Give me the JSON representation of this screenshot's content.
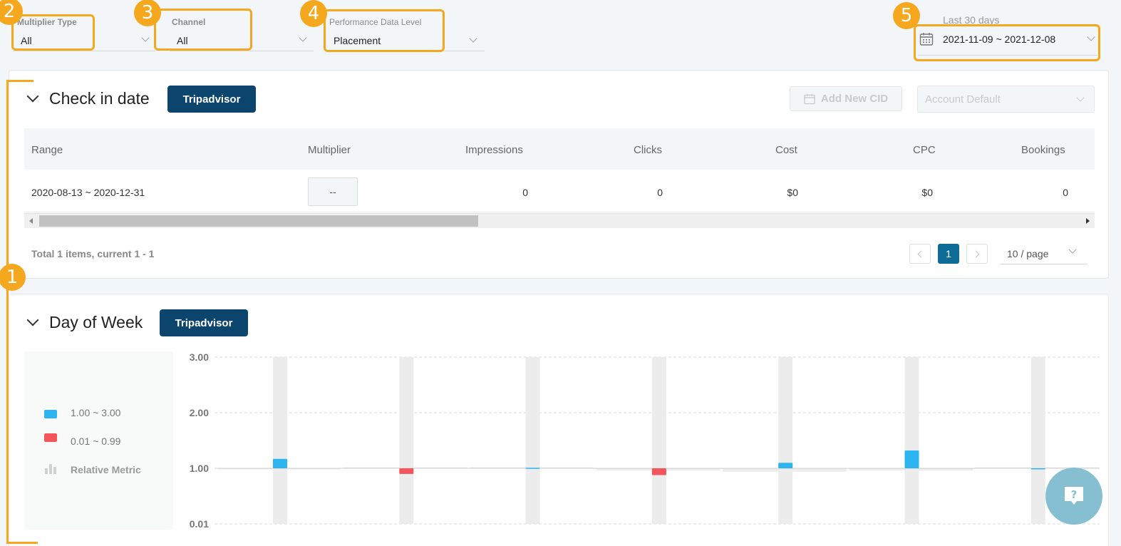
{
  "filters": {
    "multiplier_type": {
      "label": "Multiplier Type",
      "value": "All"
    },
    "channel": {
      "label": "Channel",
      "value": "All"
    },
    "performance_level": {
      "label": "Performance Data Level",
      "value": "Placement"
    },
    "date": {
      "label": "Last 30 days",
      "value": "2021-11-09 ~ 2021-12-08"
    }
  },
  "badges": [
    "1",
    "2",
    "3",
    "4",
    "5"
  ],
  "checkin": {
    "title": "Check in date",
    "tag": "Tripadvisor",
    "add_button": "Add New CID",
    "account_select": "Account Default",
    "columns": [
      "Range",
      "Multiplier",
      "Impressions",
      "Clicks",
      "Cost",
      "CPC",
      "Bookings"
    ],
    "row": {
      "range": "2020-08-13 ~ 2020-12-31",
      "multiplier": "--",
      "impressions": "0",
      "clicks": "0",
      "cost": "$0",
      "cpc": "$0",
      "bookings": "0"
    },
    "total": "Total 1 items, current 1 - 1",
    "page": "1",
    "page_size": "10 / page"
  },
  "dow": {
    "title": "Day of Week",
    "tag": "Tripadvisor",
    "legend": [
      {
        "label": "1.00 ~ 3.00",
        "color": "#2cb5f1"
      },
      {
        "label": "0.01 ~ 0.99",
        "color": "#f2555b"
      },
      {
        "label": "Relative Metric",
        "color": "#d0d0d0"
      }
    ]
  },
  "chart_data": {
    "type": "bar",
    "yticks": [
      "3.00",
      "2.00",
      "1.00",
      "0.01"
    ],
    "baseline": 1.0,
    "multipliers": [
      1.17,
      0.9,
      1.01,
      0.88,
      1.1,
      1.32,
      1.0
    ],
    "relative_metric": [
      1.0,
      1.02,
      1.02,
      0.96,
      0.94,
      0.96,
      1.02
    ]
  },
  "colors": {
    "accent": "#f5a71d",
    "tag": "#0b456d",
    "page": "#0e6d96",
    "help": "#86bfd2"
  }
}
